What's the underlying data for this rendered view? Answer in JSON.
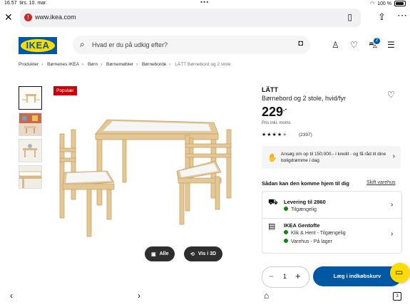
{
  "status_bar": {
    "time": "16.57",
    "date": "tirs. 10. mar.",
    "battery": "100 %"
  },
  "browser": {
    "url": "www.ikea.com"
  },
  "header": {
    "logo_text": "IKEA",
    "search_placeholder": "Hvad er du på udkig efter?",
    "cart_count": "2"
  },
  "breadcrumb": [
    "Produkter",
    "Børnenes IKEA",
    "Børn",
    "Børnemøbler",
    "Børneborde",
    "LÄTT Børnebord og 2 stole"
  ],
  "gallery": {
    "badge": "Populær",
    "all_label": "Alle",
    "view3d_label": "Vis i 3D"
  },
  "product": {
    "name": "LÄTT",
    "description": "Børnebord og 2 stole, hvid/fyr",
    "price": "229",
    "price_suffix": ".-",
    "price_note": "Pris inkl. moms",
    "rating": 4.5,
    "review_count": "(2397)"
  },
  "credit": {
    "text": "Ansøg om op til 150.000.- i kredit - og få råd til dine boligdrømme i dag"
  },
  "availability": {
    "heading": "Sådan kan den komme hjem til dig",
    "change_store": "Skift varehus",
    "delivery_title": "Levering til 2860",
    "delivery_status": "Tilgængelig",
    "store_title": "IKEA Gentofte",
    "store_line1": "Klik & Hent - Tilgængelig",
    "store_line2": "Varehus - På lager"
  },
  "purchase": {
    "quantity": "1",
    "add_to_cart": "Læg i indkøbskurv"
  },
  "toolbar": {
    "tab_count": "3"
  },
  "colors": {
    "ikea_blue": "#0058a3",
    "ikea_yellow": "#ffdb00",
    "badge_red": "#cc0008",
    "stock_green": "#0a8a00"
  }
}
